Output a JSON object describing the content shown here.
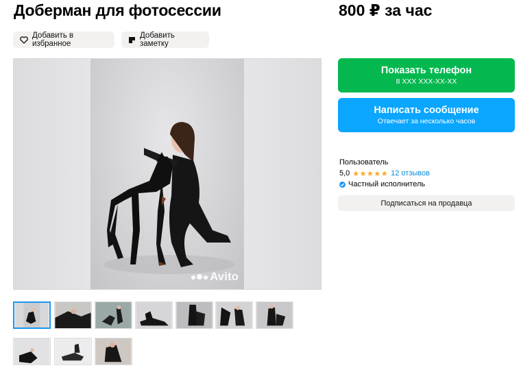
{
  "listing": {
    "title": "Доберман для фотосессии",
    "price": "800 ₽ за час"
  },
  "actions": {
    "favorite_label": "Добавить в избранное",
    "note_label": "Добавить заметку"
  },
  "gallery": {
    "watermark": "Avito",
    "thumbnail_count": 10,
    "active_index": 0
  },
  "contact": {
    "phone_label": "Показать телефон",
    "phone_masked": "8 XXX XXX-XX-XX",
    "message_label": "Написать сообщение",
    "message_sub": "Отвечает за несколько часов"
  },
  "seller": {
    "name": "Пользователь",
    "rating": "5,0",
    "stars": "★★★★★",
    "reviews": "12 отзывов",
    "type": "Частный исполнитель",
    "subscribe_label": "Подписаться на продавца"
  },
  "colors": {
    "phone_button": "#04b84f",
    "message_button": "#0aa6ff",
    "stars": "#ffa51e",
    "link": "#0a8ad6"
  },
  "icons": [
    "heart-icon",
    "note-icon",
    "verified-icon",
    "avito-logo-icon"
  ]
}
